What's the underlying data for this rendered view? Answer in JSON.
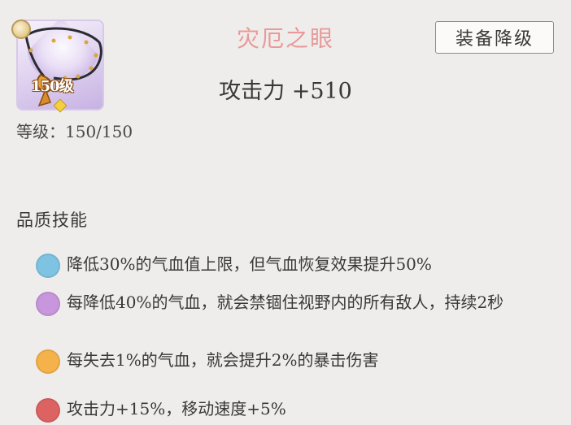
{
  "item": {
    "name": "灾厄之眼",
    "level_tag": "150级",
    "level_label": "等级：150/150",
    "stat": "攻击力 +510",
    "icon": "necklace-icon"
  },
  "actions": {
    "downgrade_label": "装备降级"
  },
  "skills": {
    "title": "品质技能",
    "items": [
      {
        "color": "#7ec4e2",
        "text": "降低30%的气血值上限，但气血恢复效果提升50%"
      },
      {
        "color": "#c896dc",
        "text": "每降低40%的气血，就会禁锢住视野内的所有敌人，持续2秒"
      },
      {
        "color": "#f5b24a",
        "text": "每失去1%的气血，就会提升2%的暴击伤害"
      },
      {
        "color": "#dd6363",
        "text": "攻击力+15%，移动速度+5%"
      }
    ]
  }
}
